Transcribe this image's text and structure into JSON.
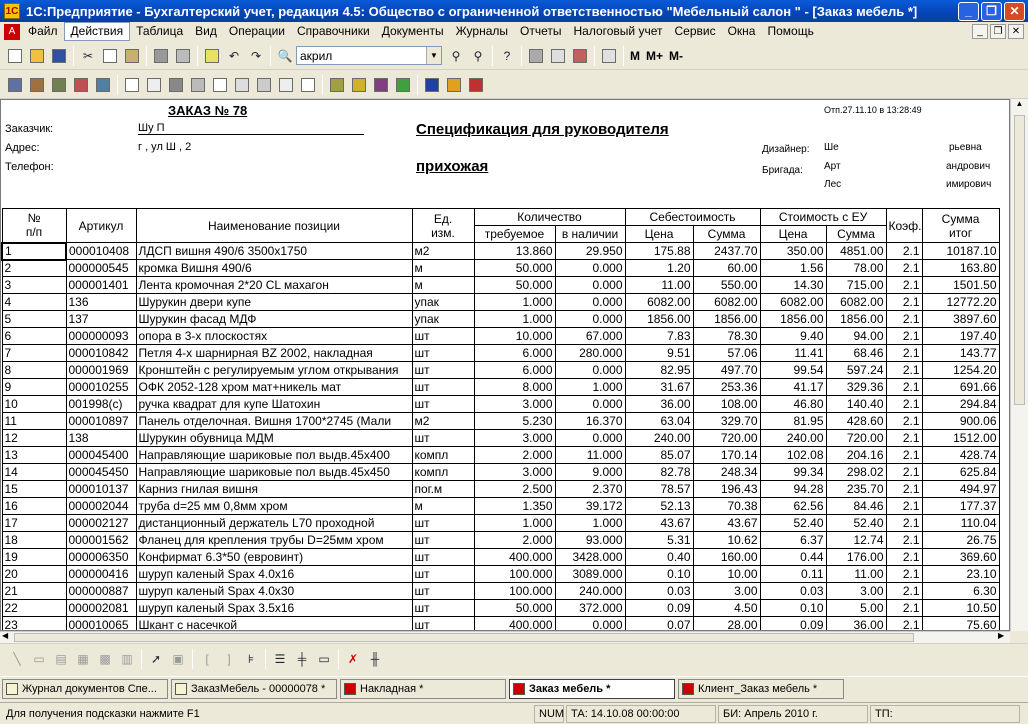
{
  "window": {
    "title": "1С:Предприятие - Бухгалтерский учет, редакция 4.5: Общество с ограниченной ответственностью \"Мебельный салон \" - [Заказ мебель  *]"
  },
  "menu": [
    "Файл",
    "Действия",
    "Таблица",
    "Вид",
    "Операции",
    "Справочники",
    "Документы",
    "Журналы",
    "Отчеты",
    "Налоговый учет",
    "Сервис",
    "Окна",
    "Помощь"
  ],
  "toolbar": {
    "search_value": "акрил",
    "m": "M",
    "mplus": "M+",
    "mminus": "M-"
  },
  "doc": {
    "order_title": "ЗАКАЗ № 78",
    "printed": "Отп.27.11.10 в 13:28:49",
    "customer_label": "Заказчик:",
    "customer_value": "Шу                    П",
    "address_label": "Адрес:",
    "address_value": "г             , ул Ш                , 2",
    "phone_label": "Телефон:",
    "spec_title": "Спецификация для руководителя",
    "room": "прихожая",
    "designer_label": "Дизайнер:",
    "designer_value": "Ше",
    "designer_tail": "рьевна",
    "brigade_label": "Бригада:",
    "brigade_1": "Арт",
    "brigade_1_tail": "андрович",
    "brigade_2": "Лес",
    "brigade_2_tail": "имирович"
  },
  "table": {
    "headers": {
      "num": "№\nп/п",
      "art": "Артикул",
      "name": "Наименование позиции",
      "unit": "Ед.\nизм.",
      "qty": "Количество",
      "qty_req": "требуемое",
      "qty_have": "в наличии",
      "cost": "Себестоимость",
      "price": "Цена",
      "sum": "Сумма",
      "eu": "Стоимость с ЕУ",
      "coef": "Коэф.",
      "total": "Сумма\nитог"
    },
    "rows": [
      [
        "1",
        "000010408",
        "ЛДСП вишня 490/6 3500x1750",
        "м2",
        "13.860",
        "29.950",
        "175.88",
        "2437.70",
        "350.00",
        "4851.00",
        "2.1",
        "10187.10"
      ],
      [
        "2",
        "000000545",
        "кромка Вишня 490/6",
        "м",
        "50.000",
        "0.000",
        "1.20",
        "60.00",
        "1.56",
        "78.00",
        "2.1",
        "163.80"
      ],
      [
        "3",
        "000001401",
        "Лента кромочная 2*20 CL махагон",
        "м",
        "50.000",
        "0.000",
        "11.00",
        "550.00",
        "14.30",
        "715.00",
        "2.1",
        "1501.50"
      ],
      [
        "4",
        "136",
        "Шурукин двери купе",
        "упак",
        "1.000",
        "0.000",
        "6082.00",
        "6082.00",
        "6082.00",
        "6082.00",
        "2.1",
        "12772.20"
      ],
      [
        "5",
        "137",
        "Шурукин фасад МДФ",
        "упак",
        "1.000",
        "0.000",
        "1856.00",
        "1856.00",
        "1856.00",
        "1856.00",
        "2.1",
        "3897.60"
      ],
      [
        "6",
        "000000093",
        "опора в 3-х плоскостях",
        "шт",
        "10.000",
        "67.000",
        "7.83",
        "78.30",
        "9.40",
        "94.00",
        "2.1",
        "197.40"
      ],
      [
        "7",
        "000010842",
        "Петля 4-х шарнирная BZ 2002, накладная",
        "шт",
        "6.000",
        "280.000",
        "9.51",
        "57.06",
        "11.41",
        "68.46",
        "2.1",
        "143.77"
      ],
      [
        "8",
        "000001969",
        "Кронштейн с регулируемым углом открывания",
        "шт",
        "6.000",
        "0.000",
        "82.95",
        "497.70",
        "99.54",
        "597.24",
        "2.1",
        "1254.20"
      ],
      [
        "9",
        "000010255",
        "ОФК 2052-128 хром мат+никель мат",
        "шт",
        "8.000",
        "1.000",
        "31.67",
        "253.36",
        "41.17",
        "329.36",
        "2.1",
        "691.66"
      ],
      [
        "10",
        "001998(с)",
        "ручка квадрат для купе Шатохин",
        "шт",
        "3.000",
        "0.000",
        "36.00",
        "108.00",
        "46.80",
        "140.40",
        "2.1",
        "294.84"
      ],
      [
        "11",
        "000010897",
        "Панель отделочная. Вишня 1700*2745 (Мали",
        "м2",
        "5.230",
        "16.370",
        "63.04",
        "329.70",
        "81.95",
        "428.60",
        "2.1",
        "900.06"
      ],
      [
        "12",
        "138",
        "Шурукин обувница МДМ",
        "шт",
        "3.000",
        "0.000",
        "240.00",
        "720.00",
        "240.00",
        "720.00",
        "2.1",
        "1512.00"
      ],
      [
        "13",
        "000045400",
        "Направляющие шариковые пол выдв.45x400",
        "компл",
        "2.000",
        "11.000",
        "85.07",
        "170.14",
        "102.08",
        "204.16",
        "2.1",
        "428.74"
      ],
      [
        "14",
        "000045450",
        "Направляющие шариковые пол выдв.45x450",
        "компл",
        "3.000",
        "9.000",
        "82.78",
        "248.34",
        "99.34",
        "298.02",
        "2.1",
        "625.84"
      ],
      [
        "15",
        "000010137",
        "Карниз гнилая вишня",
        "пог.м",
        "2.500",
        "2.370",
        "78.57",
        "196.43",
        "94.28",
        "235.70",
        "2.1",
        "494.97"
      ],
      [
        "16",
        "000002044",
        "труба d=25 мм 0,8мм хром",
        "м",
        "1.350",
        "39.172",
        "52.13",
        "70.38",
        "62.56",
        "84.46",
        "2.1",
        "177.37"
      ],
      [
        "17",
        "000002127",
        "дистанционный держатель L70 проходной",
        "шт",
        "1.000",
        "1.000",
        "43.67",
        "43.67",
        "52.40",
        "52.40",
        "2.1",
        "110.04"
      ],
      [
        "18",
        "000001562",
        "Фланец для крепления трубы D=25мм хром",
        "шт",
        "2.000",
        "93.000",
        "5.31",
        "10.62",
        "6.37",
        "12.74",
        "2.1",
        "26.75"
      ],
      [
        "19",
        "000006350",
        "Конфирмат 6.3*50 (евровинт)",
        "шт",
        "400.000",
        "3428.000",
        "0.40",
        "160.00",
        "0.44",
        "176.00",
        "2.1",
        "369.60"
      ],
      [
        "20",
        "000000416",
        "шуруп каленый Spax 4.0x16",
        "шт",
        "100.000",
        "3089.000",
        "0.10",
        "10.00",
        "0.11",
        "11.00",
        "2.1",
        "23.10"
      ],
      [
        "21",
        "000000887",
        "шуруп каленый Spax 4.0x30",
        "шт",
        "100.000",
        "240.000",
        "0.03",
        "3.00",
        "0.03",
        "3.00",
        "2.1",
        "6.30"
      ],
      [
        "22",
        "000002081",
        "шуруп каленый Spax 3.5x16",
        "шт",
        "50.000",
        "372.000",
        "0.09",
        "4.50",
        "0.10",
        "5.00",
        "2.1",
        "10.50"
      ],
      [
        "23",
        "000010065",
        "Шкант с насечкой",
        "шт",
        "400.000",
        "0.000",
        "0.07",
        "28.00",
        "0.09",
        "36.00",
        "2.1",
        "75.60"
      ]
    ]
  },
  "tasks": [
    "Журнал документов  Спе...",
    "ЗаказМебель - 00000078 *",
    "Накладная  *",
    "Заказ мебель  *",
    "Клиент_Заказ мебель  *"
  ],
  "status": {
    "hint": "Для получения подсказки нажмите F1",
    "num": "NUM",
    "ta": "ТА: 14.10.08  00:00:00",
    "bi": "БИ: Апрель 2010 г.",
    "tp": "ТП:"
  }
}
